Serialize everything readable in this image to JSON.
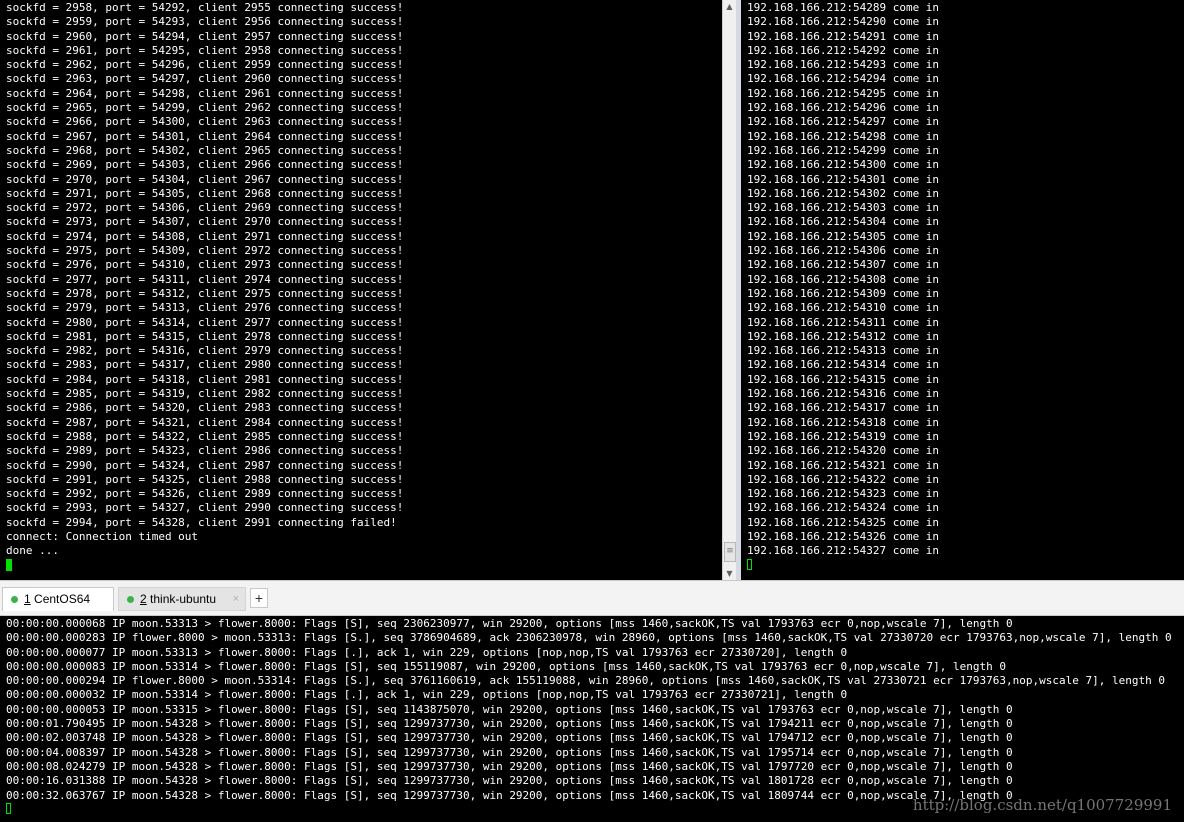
{
  "left_terminal": {
    "lines": [
      "sockfd = 2958, port = 54292, client 2955 connecting success!",
      "sockfd = 2959, port = 54293, client 2956 connecting success!",
      "sockfd = 2960, port = 54294, client 2957 connecting success!",
      "sockfd = 2961, port = 54295, client 2958 connecting success!",
      "sockfd = 2962, port = 54296, client 2959 connecting success!",
      "sockfd = 2963, port = 54297, client 2960 connecting success!",
      "sockfd = 2964, port = 54298, client 2961 connecting success!",
      "sockfd = 2965, port = 54299, client 2962 connecting success!",
      "sockfd = 2966, port = 54300, client 2963 connecting success!",
      "sockfd = 2967, port = 54301, client 2964 connecting success!",
      "sockfd = 2968, port = 54302, client 2965 connecting success!",
      "sockfd = 2969, port = 54303, client 2966 connecting success!",
      "sockfd = 2970, port = 54304, client 2967 connecting success!",
      "sockfd = 2971, port = 54305, client 2968 connecting success!",
      "sockfd = 2972, port = 54306, client 2969 connecting success!",
      "sockfd = 2973, port = 54307, client 2970 connecting success!",
      "sockfd = 2974, port = 54308, client 2971 connecting success!",
      "sockfd = 2975, port = 54309, client 2972 connecting success!",
      "sockfd = 2976, port = 54310, client 2973 connecting success!",
      "sockfd = 2977, port = 54311, client 2974 connecting success!",
      "sockfd = 2978, port = 54312, client 2975 connecting success!",
      "sockfd = 2979, port = 54313, client 2976 connecting success!",
      "sockfd = 2980, port = 54314, client 2977 connecting success!",
      "sockfd = 2981, port = 54315, client 2978 connecting success!",
      "sockfd = 2982, port = 54316, client 2979 connecting success!",
      "sockfd = 2983, port = 54317, client 2980 connecting success!",
      "sockfd = 2984, port = 54318, client 2981 connecting success!",
      "sockfd = 2985, port = 54319, client 2982 connecting success!",
      "sockfd = 2986, port = 54320, client 2983 connecting success!",
      "sockfd = 2987, port = 54321, client 2984 connecting success!",
      "sockfd = 2988, port = 54322, client 2985 connecting success!",
      "sockfd = 2989, port = 54323, client 2986 connecting success!",
      "sockfd = 2990, port = 54324, client 2987 connecting success!",
      "sockfd = 2991, port = 54325, client 2988 connecting success!",
      "sockfd = 2992, port = 54326, client 2989 connecting success!",
      "sockfd = 2993, port = 54327, client 2990 connecting success!",
      "sockfd = 2994, port = 54328, client 2991 connecting failed!",
      "connect: Connection timed out",
      "done ..."
    ]
  },
  "right_terminal": {
    "lines": [
      "192.168.166.212:54289 come in",
      "192.168.166.212:54290 come in",
      "192.168.166.212:54291 come in",
      "192.168.166.212:54292 come in",
      "192.168.166.212:54293 come in",
      "192.168.166.212:54294 come in",
      "192.168.166.212:54295 come in",
      "192.168.166.212:54296 come in",
      "192.168.166.212:54297 come in",
      "192.168.166.212:54298 come in",
      "192.168.166.212:54299 come in",
      "192.168.166.212:54300 come in",
      "192.168.166.212:54301 come in",
      "192.168.166.212:54302 come in",
      "192.168.166.212:54303 come in",
      "192.168.166.212:54304 come in",
      "192.168.166.212:54305 come in",
      "192.168.166.212:54306 come in",
      "192.168.166.212:54307 come in",
      "192.168.166.212:54308 come in",
      "192.168.166.212:54309 come in",
      "192.168.166.212:54310 come in",
      "192.168.166.212:54311 come in",
      "192.168.166.212:54312 come in",
      "192.168.166.212:54313 come in",
      "192.168.166.212:54314 come in",
      "192.168.166.212:54315 come in",
      "192.168.166.212:54316 come in",
      "192.168.166.212:54317 come in",
      "192.168.166.212:54318 come in",
      "192.168.166.212:54319 come in",
      "192.168.166.212:54320 come in",
      "192.168.166.212:54321 come in",
      "192.168.166.212:54322 come in",
      "192.168.166.212:54323 come in",
      "192.168.166.212:54324 come in",
      "192.168.166.212:54325 come in",
      "192.168.166.212:54326 come in",
      "192.168.166.212:54327 come in"
    ]
  },
  "tabs": [
    {
      "num": "1",
      "name": " CentOS64",
      "status_color": "#3cb34a"
    },
    {
      "num": "2",
      "name": " think-ubuntu",
      "status_color": "#3cb34a"
    }
  ],
  "add_tab_label": "+",
  "close_glyph": "×",
  "scrollbar": {
    "up_glyph": "▲",
    "down_glyph": "▼",
    "thumb_glyph": "≡"
  },
  "bottom_terminal": {
    "lines": [
      "00:00:00.000068 IP moon.53313 > flower.8000: Flags [S], seq 2306230977, win 29200, options [mss 1460,sackOK,TS val 1793763 ecr 0,nop,wscale 7], length 0",
      "00:00:00.000283 IP flower.8000 > moon.53313: Flags [S.], seq 3786904689, ack 2306230978, win 28960, options [mss 1460,sackOK,TS val 27330720 ecr 1793763,nop,wscale 7], length 0",
      "00:00:00.000077 IP moon.53313 > flower.8000: Flags [.], ack 1, win 229, options [nop,nop,TS val 1793763 ecr 27330720], length 0",
      "00:00:00.000083 IP moon.53314 > flower.8000: Flags [S], seq 155119087, win 29200, options [mss 1460,sackOK,TS val 1793763 ecr 0,nop,wscale 7], length 0",
      "00:00:00.000294 IP flower.8000 > moon.53314: Flags [S.], seq 3761160619, ack 155119088, win 28960, options [mss 1460,sackOK,TS val 27330721 ecr 1793763,nop,wscale 7], length 0",
      "00:00:00.000032 IP moon.53314 > flower.8000: Flags [.], ack 1, win 229, options [nop,nop,TS val 1793763 ecr 27330721], length 0",
      "00:00:00.000053 IP moon.53315 > flower.8000: Flags [S], seq 1143875070, win 29200, options [mss 1460,sackOK,TS val 1793763 ecr 0,nop,wscale 7], length 0",
      "00:00:01.790495 IP moon.54328 > flower.8000: Flags [S], seq 1299737730, win 29200, options [mss 1460,sackOK,TS val 1794211 ecr 0,nop,wscale 7], length 0",
      "00:00:02.003748 IP moon.54328 > flower.8000: Flags [S], seq 1299737730, win 29200, options [mss 1460,sackOK,TS val 1794712 ecr 0,nop,wscale 7], length 0",
      "00:00:04.008397 IP moon.54328 > flower.8000: Flags [S], seq 1299737730, win 29200, options [mss 1460,sackOK,TS val 1795714 ecr 0,nop,wscale 7], length 0",
      "00:00:08.024279 IP moon.54328 > flower.8000: Flags [S], seq 1299737730, win 29200, options [mss 1460,sackOK,TS val 1797720 ecr 0,nop,wscale 7], length 0",
      "00:00:16.031388 IP moon.54328 > flower.8000: Flags [S], seq 1299737730, win 29200, options [mss 1460,sackOK,TS val 1801728 ecr 0,nop,wscale 7], length 0",
      "00:00:32.063767 IP moon.54328 > flower.8000: Flags [S], seq 1299737730, win 29200, options [mss 1460,sackOK,TS val 1809744 ecr 0,nop,wscale 7], length 0"
    ]
  },
  "watermark": "http://blog.csdn.net/q1007729991",
  "colors": {
    "cursor": "#00e000",
    "background": "#000000",
    "text": "#ffffff"
  }
}
